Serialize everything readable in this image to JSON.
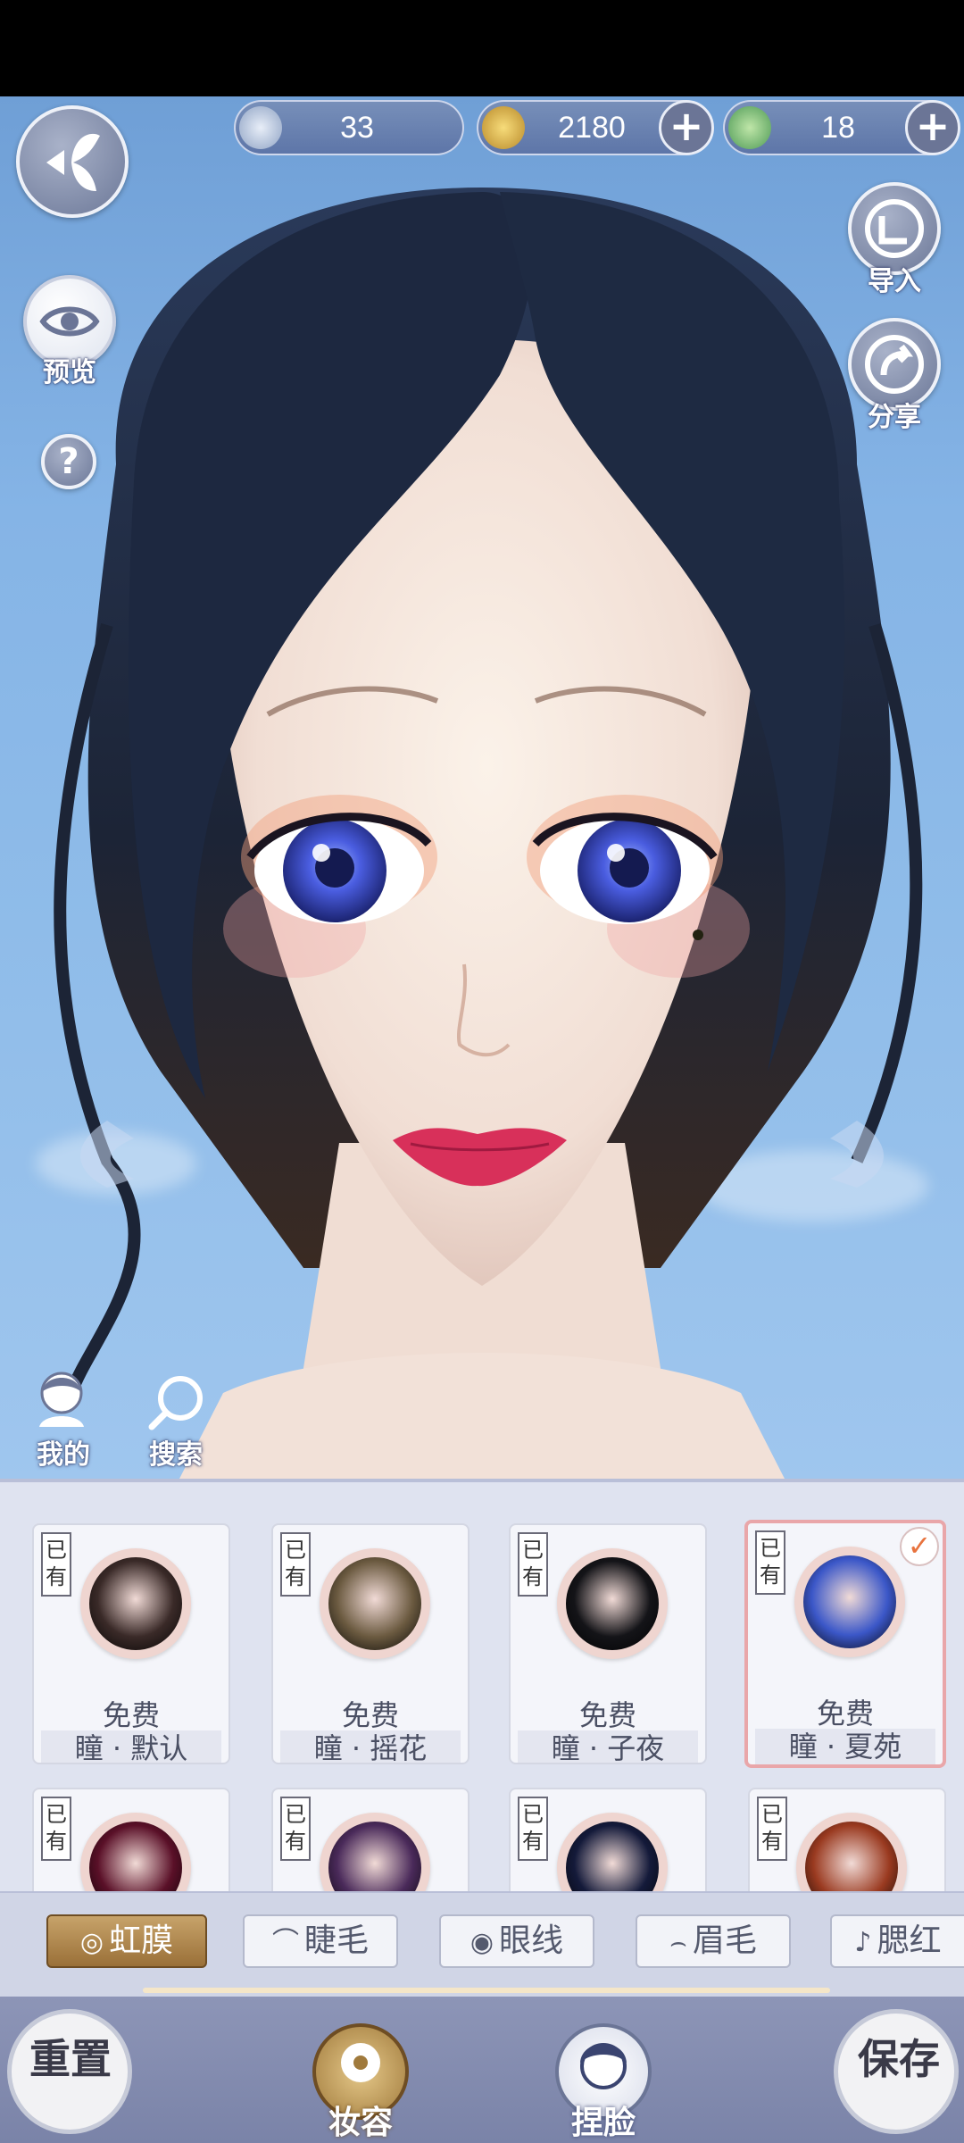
{
  "currency": {
    "silver_value": "33",
    "gold_value": "2180",
    "jade_value": "18"
  },
  "left_buttons": {
    "preview_label": "预览",
    "my_label": "我的",
    "search_label": "搜索",
    "help_label": "?"
  },
  "right_buttons": {
    "import_label": "导入",
    "share_label": "分享"
  },
  "owned_badge": "已有",
  "cards": [
    {
      "price": "免费",
      "name": "瞳 · 默认",
      "color": "#3a2a28"
    },
    {
      "price": "免费",
      "name": "瞳 · 摇花",
      "color": "#6b5a40"
    },
    {
      "price": "免费",
      "name": "瞳 · 子夜",
      "color": "#141418"
    },
    {
      "price": "免费",
      "name": "瞳 · 夏苑",
      "color": "#3b57c8"
    },
    {
      "color": "#5a1028"
    },
    {
      "color": "#4a2a5a"
    },
    {
      "color": "#141a3a"
    },
    {
      "color": "#9a3a20"
    }
  ],
  "tabs": [
    {
      "label": "虹膜",
      "icon": "iris-icon"
    },
    {
      "label": "睫毛",
      "icon": "eyelash-icon"
    },
    {
      "label": "眼线",
      "icon": "eyeliner-icon"
    },
    {
      "label": "眉毛",
      "icon": "eyebrow-icon"
    },
    {
      "label": "腮红",
      "icon": "blush-icon"
    }
  ],
  "bottom_nav": {
    "reset_label": "重置",
    "makeup_label": "妆容",
    "face_label": "捏脸",
    "save_label": "保存"
  },
  "colors": {
    "active_tab": "#b08850",
    "selected_border": "#e9a6a9",
    "check": "#e8733e"
  }
}
